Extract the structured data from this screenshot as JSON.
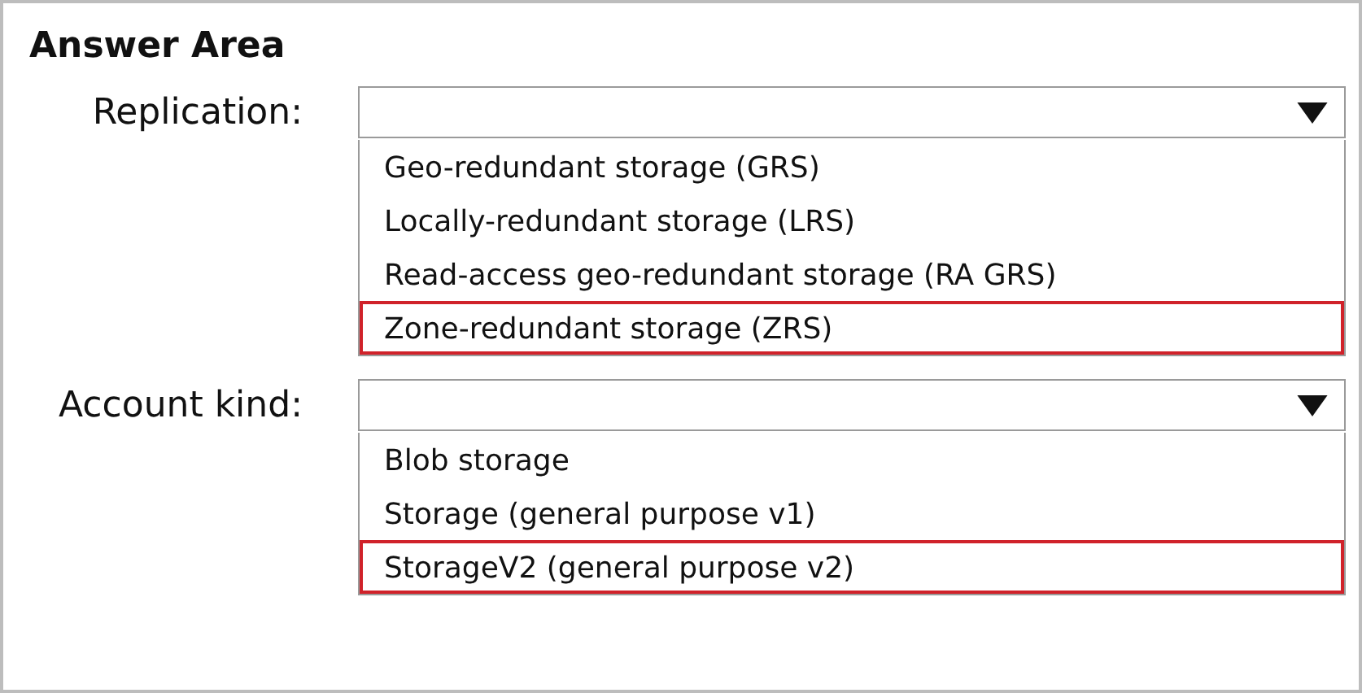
{
  "title": "Answer Area",
  "questions": [
    {
      "label": "Replication:",
      "options": [
        {
          "text": "Geo-redundant storage (GRS)",
          "selected": false
        },
        {
          "text": "Locally-redundant storage (LRS)",
          "selected": false
        },
        {
          "text": "Read-access geo-redundant storage (RA GRS)",
          "selected": false
        },
        {
          "text": "Zone-redundant storage (ZRS)",
          "selected": true
        }
      ]
    },
    {
      "label": "Account kind:",
      "options": [
        {
          "text": "Blob storage",
          "selected": false
        },
        {
          "text": "Storage (general purpose v1)",
          "selected": false
        },
        {
          "text": "StorageV2 (general purpose v2)",
          "selected": true
        }
      ]
    }
  ]
}
